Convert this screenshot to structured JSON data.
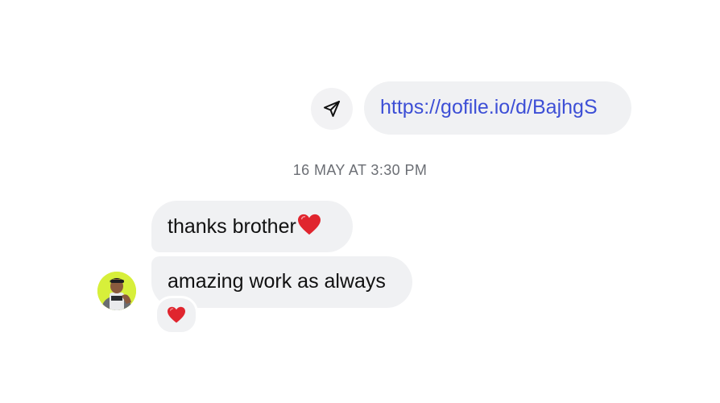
{
  "thread": {
    "outgoing": {
      "link_text": "https://gofile.io/d/BajhgS",
      "share_icon": "send-arrow-icon"
    },
    "timestamp": "16 MAY AT 3:30 PM",
    "incoming": [
      {
        "text": "thanks brother",
        "trailing_emoji": "red-heart-icon"
      },
      {
        "text": "amazing work as always",
        "reaction": "red-heart-icon"
      }
    ]
  },
  "colors": {
    "bubble_bg": "#f0f1f3",
    "link": "#3d4fd6",
    "timestamp": "#6b6e74",
    "heart": "#e0252e",
    "avatar_bg": "#d7ef3a"
  }
}
